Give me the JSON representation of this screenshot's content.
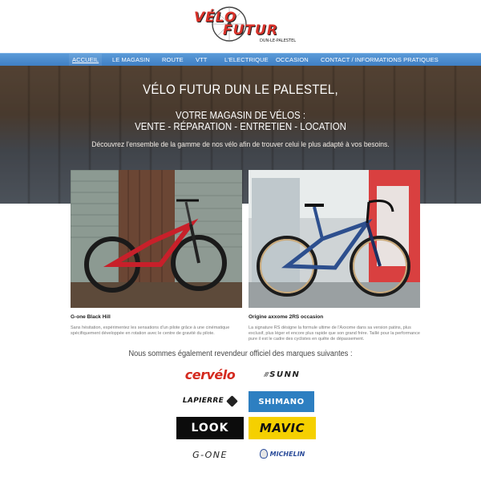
{
  "logo": {
    "line1": "VÉLO",
    "line2": "FUTUR",
    "tagline": "DUN-LE-PALESTEL"
  },
  "nav": {
    "items": [
      {
        "label": "ACCUEIL",
        "active": true
      },
      {
        "label": "LE MAGASIN"
      },
      {
        "label": "ROUTE"
      },
      {
        "label": "VTT"
      },
      {
        "label": "L'ELECTRIQUE"
      },
      {
        "label": "OCCASION"
      },
      {
        "label": "CONTACT / INFORMATIONS PRATIQUES"
      }
    ]
  },
  "hero": {
    "title": "VÉLO FUTUR DUN LE PALESTEL,",
    "subtitle_line1": "VOTRE MAGASIN DE VÉLOS :",
    "subtitle_line2": "VENTE - RÉPARATION - ENTRETIEN - LOCATION",
    "description": "Découvrez l'ensemble de la gamme de nos vélo afin de trouver celui le plus adapté à vos besoins."
  },
  "products": [
    {
      "title": "G-one Black Hill",
      "description": "Sans hésitation, expérimentez les sensations d'un pilote grâce à une cinématique spécifiquement développée en rotation avec le centre de gravité du pilote."
    },
    {
      "title": "Origine axxome 2RS occasion",
      "description": "La signature RS désigne la formule ultime de l'Axxome dans sa version patins, plus exclusif, plus léger et encore plus rapide que son grand frère. Taillé pour la performance pure il est le cadre des cyclistes en quête de dépassement."
    }
  ],
  "brands_heading": "Nous sommes également revendeur officiel des marques suivantes :",
  "brands": {
    "cervelo": "cervélo",
    "sunn": "SUNN",
    "lapierre": "LAPIERRE",
    "shimano": "SHIMANO",
    "look": "LOOK",
    "mavic": "MAVIC",
    "gone": "G-ONE",
    "michelin": "MICHELIN"
  },
  "colors": {
    "nav": "#4a8ad0",
    "cervelo": "#d42a1f",
    "shimano": "#2d7fc1",
    "mavic_bg": "#f5d000"
  }
}
